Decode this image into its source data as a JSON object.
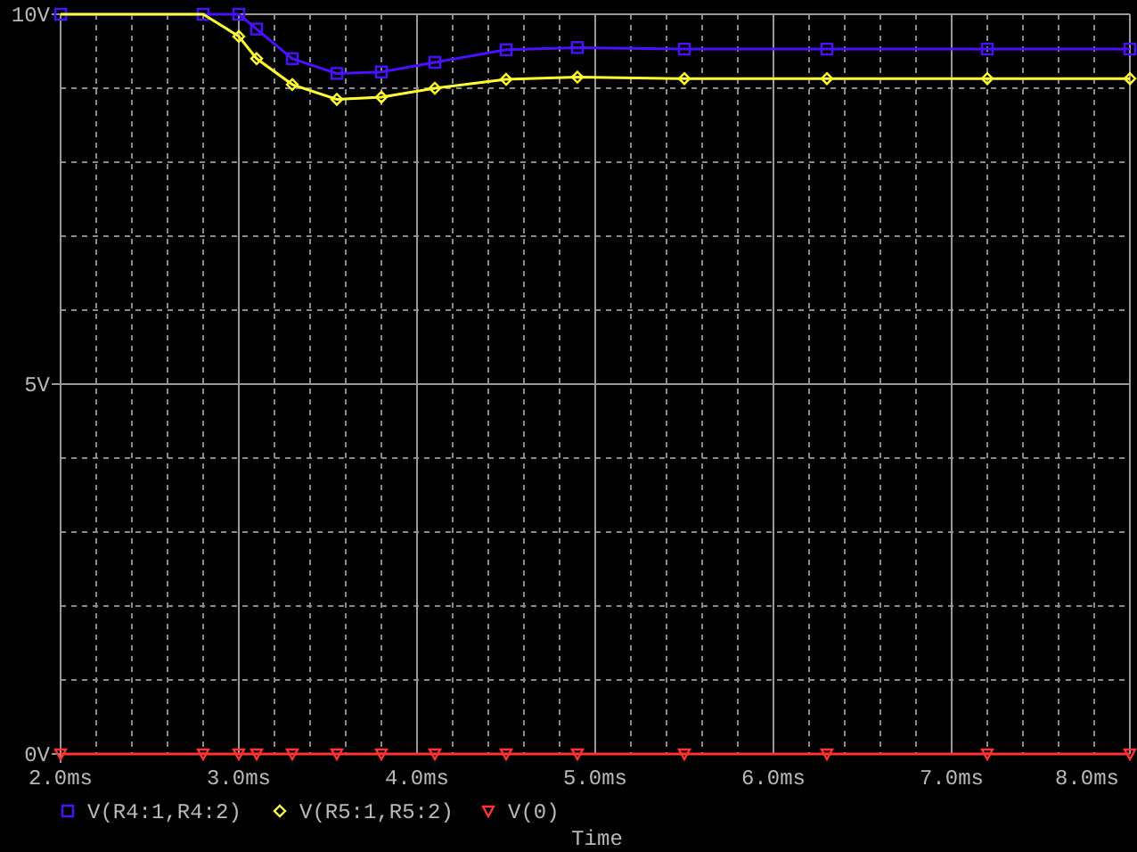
{
  "plot": {
    "chart_data": {
      "type": "line",
      "xlabel": "Time",
      "grid": true,
      "legend": true,
      "x": [
        2.0,
        2.8,
        3.0,
        3.1,
        3.3,
        3.55,
        3.8,
        4.1,
        4.5,
        4.9,
        5.5,
        6.3,
        7.2,
        8.0
      ],
      "series": [
        {
          "name": "V(R4:1,R4:2)",
          "color": "#4b10ff",
          "marker": "square",
          "values": [
            10,
            10,
            10,
            9.8,
            9.4,
            9.2,
            9.22,
            9.35,
            9.52,
            9.55,
            9.53,
            9.53,
            9.53,
            9.53
          ]
        },
        {
          "name": "V(R5:1,R5:2)",
          "color": "#ffff33",
          "marker": "diamond",
          "values": [
            10,
            10,
            9.7,
            9.4,
            9.05,
            8.85,
            8.88,
            9.0,
            9.12,
            9.15,
            9.13,
            9.13,
            9.13,
            9.13
          ]
        },
        {
          "name": "V(0)",
          "color": "#ff3333",
          "marker": "triangle",
          "values": [
            0,
            0,
            0,
            0,
            0,
            0,
            0,
            0,
            0,
            0,
            0,
            0,
            0,
            0
          ]
        }
      ],
      "xlim": [
        2.0,
        8.0
      ],
      "ylim": [
        0,
        10
      ],
      "xticks": [
        {
          "value": 2,
          "label": "2.0ms"
        },
        {
          "value": 3,
          "label": "3.0ms"
        },
        {
          "value": 4,
          "label": "4.0ms"
        },
        {
          "value": 5,
          "label": "5.0ms"
        },
        {
          "value": 6,
          "label": "6.0ms"
        },
        {
          "value": 7,
          "label": "7.0ms"
        },
        {
          "value": 8,
          "label": "8.0ms"
        }
      ],
      "yticks": [
        {
          "value": 0,
          "label": "0V"
        },
        {
          "value": 5,
          "label": "5V"
        },
        {
          "value": 10,
          "label": "10V"
        }
      ]
    }
  }
}
